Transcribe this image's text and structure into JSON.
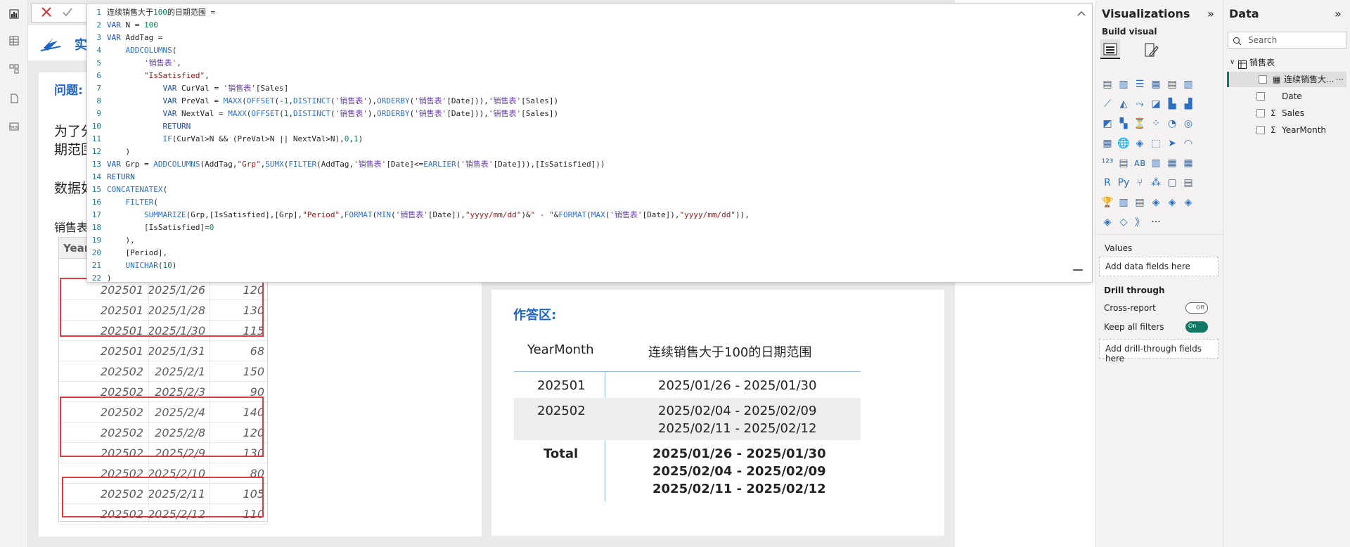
{
  "formula_bar": {
    "cancel_icon": "close-icon",
    "commit_icon": "check-icon",
    "collapse_icon": "chevron-up-icon",
    "lines": [
      "连续销售大于100的日期范围 =",
      "VAR N = 100",
      "VAR AddTag =",
      "    ADDCOLUMNS(",
      "        '销售表',",
      "        \"IsSatisfied\",",
      "            VAR CurVal = '销售表'[Sales]",
      "            VAR PreVal = MAXX(OFFSET(-1,DISTINCT('销售表'),ORDERBY('销售表'[Date])),'销售表'[Sales])",
      "            VAR NextVal = MAXX(OFFSET(1,DISTINCT('销售表'),ORDERBY('销售表'[Date])),'销售表'[Sales])",
      "            RETURN",
      "            IF(CurVal>N && (PreVal>N || NextVal>N),0,1)",
      "    )",
      "VAR Grp = ADDCOLUMNS(AddTag,\"Grp\",SUMX(FILTER(AddTag,'销售表'[Date]<=EARLIER('销售表'[Date])),[IsSatisfied]))",
      "RETURN",
      "CONCATENATEX(",
      "    FILTER(",
      "        SUMMARIZE(Grp,[IsSatisfied],[Grp],\"Period\",FORMAT(MIN('销售表'[Date]),\"yyyy/mm/dd\")&\" - \"&FORMAT(MAX('销售表'[Date]),\"yyyy/mm/dd\")),",
      "        [IsSatisfied]=0",
      "    ),",
      "    [Period],",
      "    UNICHAR(10)",
      ")"
    ]
  },
  "report": {
    "title_partial": "实",
    "question_label": "问题:",
    "question_line1": "为了分",
    "question_line2": "期范围",
    "data_label": "数据如",
    "table_label": "销售表",
    "table_header_partial": "Year",
    "sales_rows": [
      {
        "ym": "202501",
        "date": "2025/1/26",
        "sales": "120"
      },
      {
        "ym": "202501",
        "date": "2025/1/28",
        "sales": "130"
      },
      {
        "ym": "202501",
        "date": "2025/1/30",
        "sales": "115"
      },
      {
        "ym": "202501",
        "date": "2025/1/31",
        "sales": "68"
      },
      {
        "ym": "202502",
        "date": "2025/2/1",
        "sales": "150"
      },
      {
        "ym": "202502",
        "date": "2025/2/3",
        "sales": "90"
      },
      {
        "ym": "202502",
        "date": "2025/2/4",
        "sales": "140"
      },
      {
        "ym": "202502",
        "date": "2025/2/8",
        "sales": "120"
      },
      {
        "ym": "202502",
        "date": "2025/2/9",
        "sales": "130"
      },
      {
        "ym": "202502",
        "date": "2025/2/10",
        "sales": "80"
      },
      {
        "ym": "202502",
        "date": "2025/2/11",
        "sales": "105"
      },
      {
        "ym": "202502",
        "date": "2025/2/12",
        "sales": "110"
      }
    ],
    "answer": {
      "title": "作答区:",
      "col1": "YearMonth",
      "col2": "连续销售大于100的日期范围",
      "row1_ym": "202501",
      "row1_val": "2025/01/26 - 2025/01/30",
      "row2_ym": "202502",
      "row2_val1": "2025/02/04 - 2025/02/09",
      "row2_val2": "2025/02/11 - 2025/02/12",
      "total_label": "Total",
      "total_val1": "2025/01/26 - 2025/01/30",
      "total_val2": "2025/02/04 - 2025/02/09",
      "total_val3": "2025/02/11 - 2025/02/12"
    }
  },
  "visualizations": {
    "title": "Visualizations",
    "build_visual": "Build visual",
    "values_label": "Values",
    "values_placeholder": "Add data fields here",
    "drill_through": "Drill through",
    "cross_report": "Cross-report",
    "cross_report_state": "Off",
    "keep_all_filters": "Keep all filters",
    "keep_all_filters_state": "On",
    "drill_placeholder": "Add drill-through fields here",
    "more": "···"
  },
  "data_pane": {
    "title": "Data",
    "search_placeholder": "Search",
    "table_name": "销售表",
    "fields": [
      {
        "name": "连续销售大...",
        "type": "measure"
      },
      {
        "name": "Date",
        "type": "column"
      },
      {
        "name": "Sales",
        "type": "sum"
      },
      {
        "name": "YearMonth",
        "type": "sum"
      }
    ],
    "field_more": "···"
  }
}
